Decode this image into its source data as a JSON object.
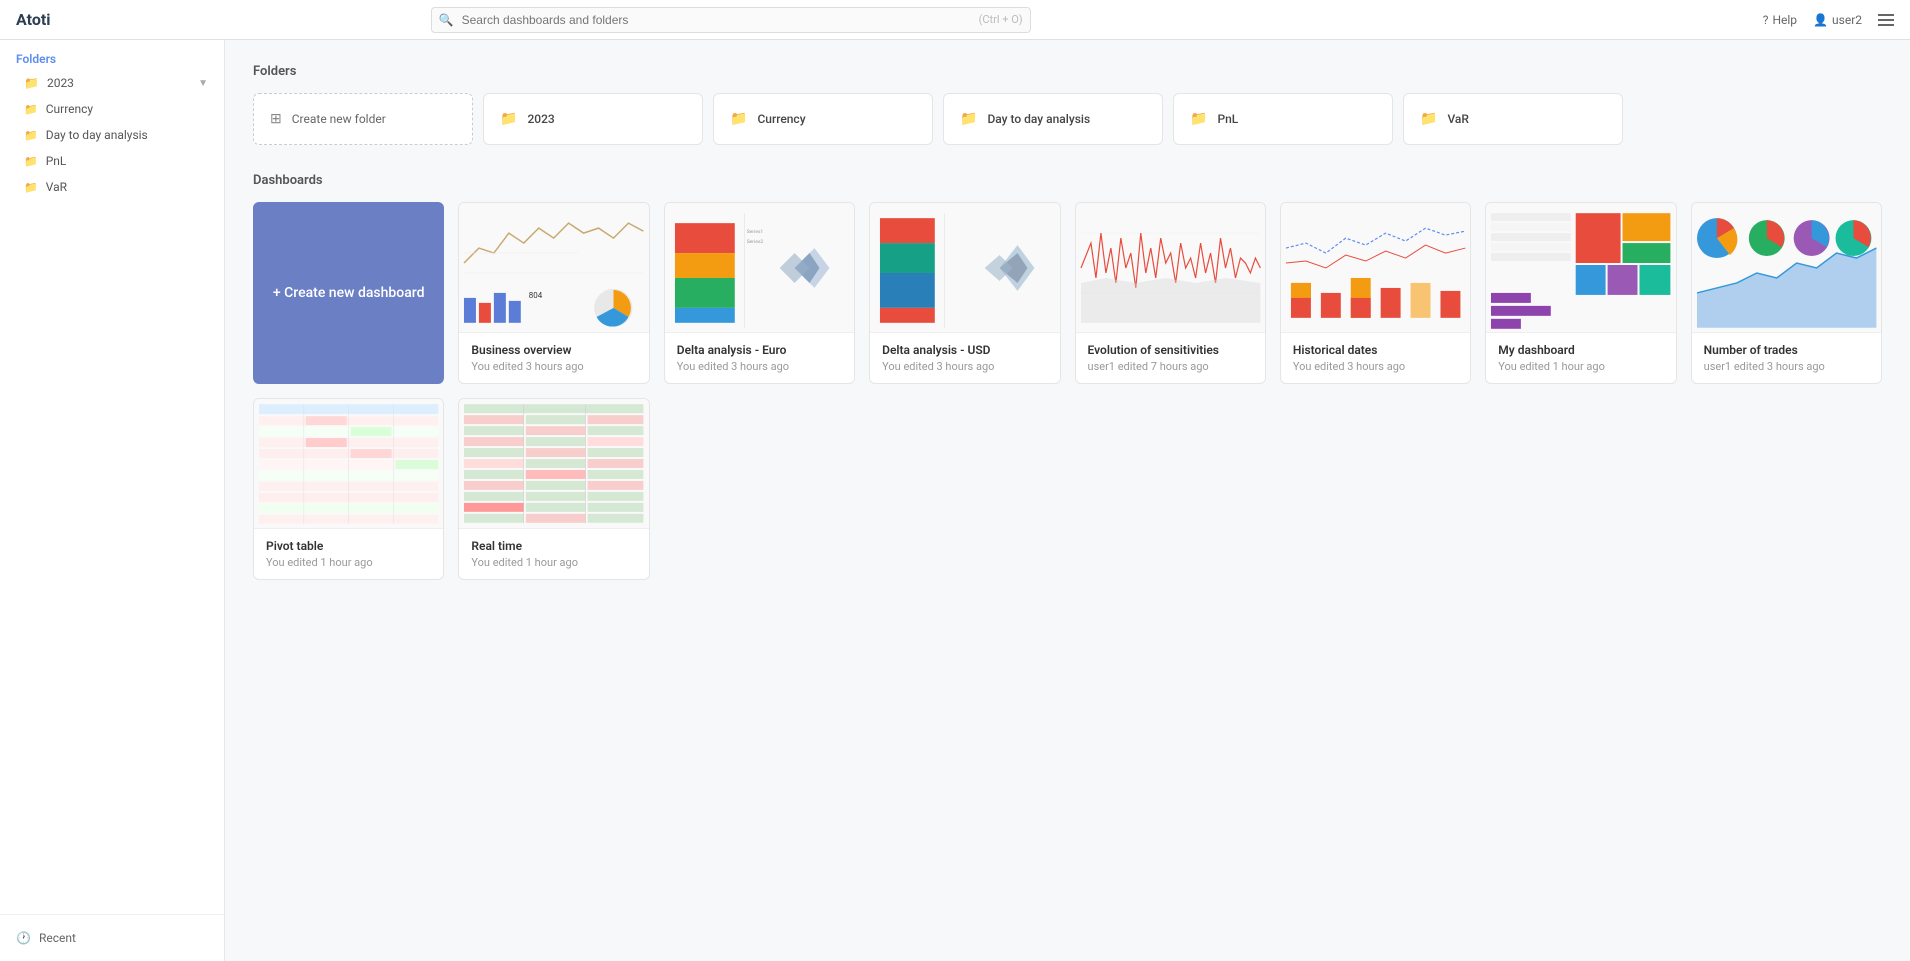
{
  "app": {
    "name": "Atoti"
  },
  "topbar": {
    "search_placeholder": "Search dashboards and folders",
    "search_shortcut": "(Ctrl + O)",
    "help_label": "Help",
    "user_label": "user2"
  },
  "sidebar": {
    "folders_label": "Folders",
    "items": [
      {
        "id": "2023",
        "label": "2023",
        "collapsed": true
      },
      {
        "id": "currency",
        "label": "Currency"
      },
      {
        "id": "day-to-day",
        "label": "Day to day analysis"
      },
      {
        "id": "pnl",
        "label": "PnL"
      },
      {
        "id": "var",
        "label": "VaR"
      }
    ],
    "recent_label": "Recent"
  },
  "main": {
    "folders_section_title": "Folders",
    "dashboards_section_title": "Dashboards",
    "folders": [
      {
        "id": "create",
        "name": "Create new folder",
        "is_create": true
      },
      {
        "id": "2023",
        "name": "2023"
      },
      {
        "id": "currency",
        "name": "Currency"
      },
      {
        "id": "day-to-day",
        "name": "Day to day analysis"
      },
      {
        "id": "pnl",
        "name": "PnL"
      },
      {
        "id": "var",
        "name": "VaR"
      }
    ],
    "dashboards": [
      {
        "id": "create",
        "name": "Create new dashboard",
        "is_create": true
      },
      {
        "id": "business-overview",
        "name": "Business overview",
        "meta": "You edited 3 hours ago"
      },
      {
        "id": "delta-euro",
        "name": "Delta analysis - Euro",
        "meta": "You edited 3 hours ago"
      },
      {
        "id": "delta-usd",
        "name": "Delta analysis - USD",
        "meta": "You edited 3 hours ago"
      },
      {
        "id": "evolution",
        "name": "Evolution of sensitivities",
        "meta": "user1 edited 7 hours ago"
      },
      {
        "id": "historical",
        "name": "Historical dates",
        "meta": "You edited 3 hours ago"
      },
      {
        "id": "my-dashboard",
        "name": "My dashboard",
        "meta": "You edited 1 hour ago"
      },
      {
        "id": "num-trades",
        "name": "Number of trades",
        "meta": "user1 edited 3 hours ago"
      },
      {
        "id": "pivot",
        "name": "Pivot table",
        "meta": "You edited 1 hour ago"
      },
      {
        "id": "real-time",
        "name": "Real time",
        "meta": "You edited 1 hour ago"
      }
    ]
  }
}
